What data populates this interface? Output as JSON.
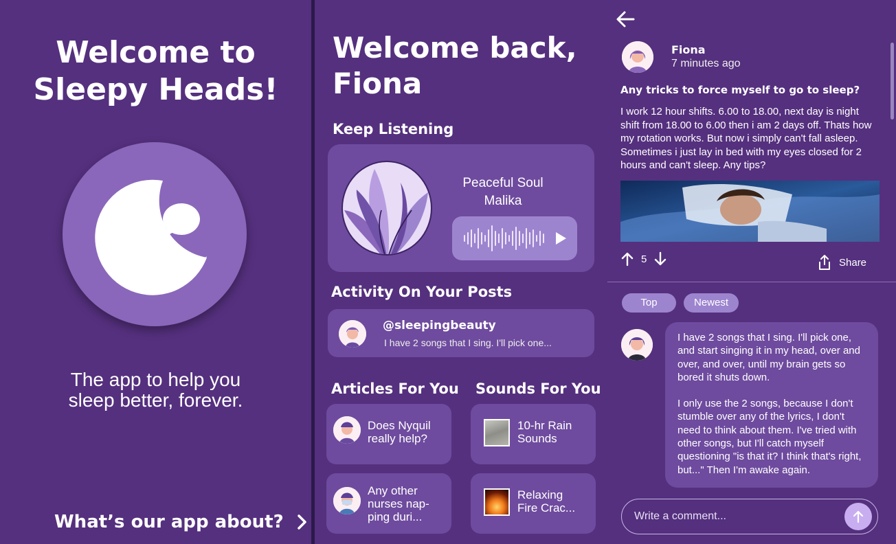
{
  "onboarding": {
    "title_line1": "Welcome to",
    "title_line2": "Sleepy Heads!",
    "tagline_line1": "The app to help you",
    "tagline_line2": "sleep better, forever.",
    "about_label": "What’s our app about?",
    "icons": {
      "logo": "moon-chat-logo",
      "next": "chevron-right-icon"
    }
  },
  "home": {
    "title_line1": "Welcome back,",
    "title_line2": "Fiona",
    "keep_listening": {
      "heading": "Keep Listening",
      "track_title": "Peaceful Soul",
      "track_artist": "Malika",
      "icons": {
        "waveform": "waveform-icon",
        "play": "play-icon"
      }
    },
    "activity": {
      "heading": "Activity On Your Posts",
      "handle": "@sleepingbeauty",
      "preview": "I have 2 songs that I sing. I'll pick one..."
    },
    "articles": {
      "heading": "Articles For You",
      "items": [
        {
          "line1": "Does Nyquil",
          "line2": "really help?",
          "line3": ""
        },
        {
          "line1": "Any other",
          "line2": "nurses nap-",
          "line3": "ping duri..."
        }
      ]
    },
    "sounds": {
      "heading": "Sounds For You",
      "items": [
        {
          "line1": "10-hr Rain",
          "line2": "Sounds"
        },
        {
          "line1": "Relaxing",
          "line2": "Fire Crac..."
        }
      ]
    }
  },
  "post": {
    "author": "Fiona",
    "time": "7 minutes ago",
    "title": "Any tricks to force myself to go to sleep?",
    "body": "I work 12 hour shifts. 6.00 to 18.00, next day is night shift from 18.00 to 6.00 then i am 2 days off. Thats how my rotation works. But now i simply can't fall asleep. Sometimes i just lay in bed with my eyes closed for 2 hours and can't sleep. Any tips?",
    "votes": "5",
    "share_label": "Share",
    "sort_top": "Top",
    "sort_newest": "Newest",
    "comment_p1": "I have 2 songs that I sing. I'll pick one, and start singing it in my head, over and over, and over, until my brain gets so bored it shuts down.",
    "comment_p2": "I only use the 2 songs, because I don't stumble over any of the lyrics, I don't need to think about them. I've tried with other songs, but I'll catch myself questioning \"is that it? I think that's right, but...\" Then I'm awake again.",
    "comment_placeholder": "Write a comment...",
    "icons": {
      "back": "back-arrow-icon",
      "upvote": "upvote-icon",
      "downvote": "downvote-icon",
      "share": "share-icon",
      "send": "send-icon"
    }
  },
  "colors": {
    "panel_bg": "#55307e",
    "card_bg": "#6e4b9e",
    "accent_light": "#9d84cf",
    "logo_circle": "#8a67bb",
    "send_btn": "#c8aef0"
  }
}
